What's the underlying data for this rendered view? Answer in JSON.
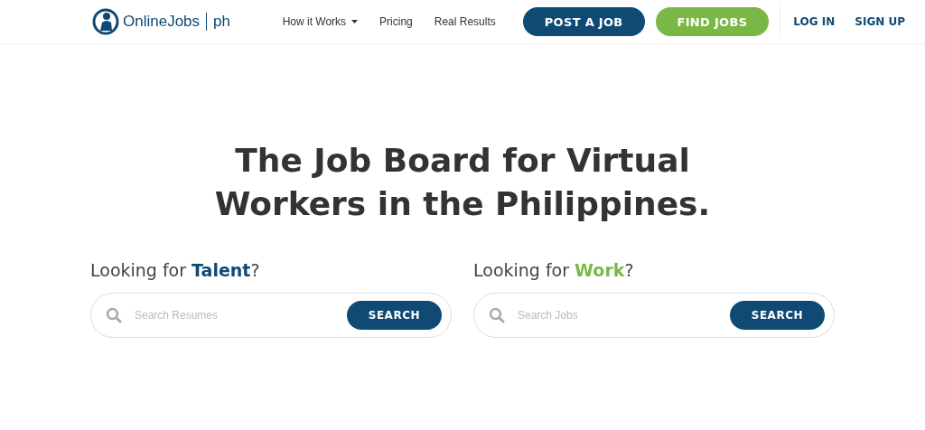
{
  "logo": {
    "name": "OnlineJobs",
    "suffix": "ph"
  },
  "nav": {
    "links": [
      {
        "label": "How it Works",
        "dropdown": true
      },
      {
        "label": "Pricing",
        "dropdown": false
      },
      {
        "label": "Real Results",
        "dropdown": false
      }
    ],
    "buttons": [
      {
        "label": "POST A JOB",
        "color": "#0e4a74"
      },
      {
        "label": "FIND JOBS",
        "color": "#7ab845"
      }
    ],
    "auth": [
      "LOG IN",
      "SIGN UP"
    ]
  },
  "headline": "The Job Board for Virtual Workers in the Philippines.",
  "searches": [
    {
      "prefix": "Looking for ",
      "highlight": "Talent",
      "suffix": "?",
      "color": "#0e4a74",
      "placeholder": "Search Resumes",
      "button": "SEARCH"
    },
    {
      "prefix": "Looking for ",
      "highlight": "Work",
      "suffix": "?",
      "color": "#7ab845",
      "placeholder": "Search Jobs",
      "button": "SEARCH"
    }
  ]
}
